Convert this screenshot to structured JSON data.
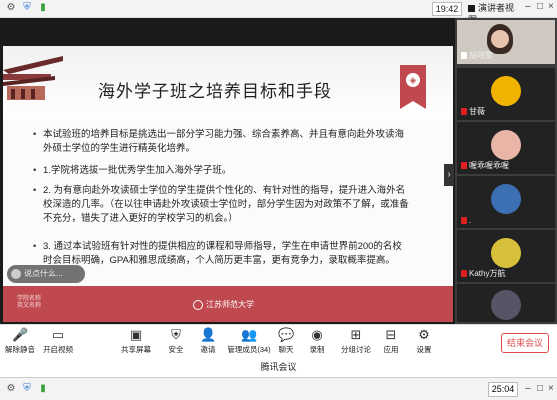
{
  "top_bar": {
    "time": "19:42",
    "view_label": "演讲者视图",
    "view_arrow": "▾",
    "icons": [
      "settings-icon",
      "shield-icon",
      "signal-icon"
    ]
  },
  "slide": {
    "title": "海外学子班之培养目标和手段",
    "badge_icon": "school-emblem-icon",
    "bullets": [
      "本试验班的培养目标是挑选出一部分学习能力强、综合素养高、并且有意向赴外攻读海外硕士学位的学生进行精英化培养。",
      "1.学院将选拔一批优秀学生加入海外学子班。",
      "2. 为有意向赴外攻读硕士学位的学生提供个性化的、有针对性的指导，提升进入海外名校深造的几率。（在以往申请赴外攻读硕士学位时，部分学生因为对政策不了解，或准备不充分，错失了进入更好的学校学习的机会。）",
      "3. 通过本试验班有针对性的提供相应的课程和导师指导，学生在申请世界前200的名校时会目标明确，GPA和雅思成绩高，个人简历更丰富，更有竞争力，录取概率提高。"
    ],
    "footer_left": "学院名称\n英文名称",
    "footer_center": "江苏师范大学",
    "say_something": "说点什么..."
  },
  "participants": [
    {
      "name": "胡晓黎",
      "muted": false
    },
    {
      "name": "甘薇",
      "muted": true
    },
    {
      "name": "喔乖喔乖喔",
      "muted": true
    },
    {
      "name": ".",
      "muted": true
    },
    {
      "name": "Kathy万航",
      "muted": true
    },
    {
      "name": "",
      "muted": true
    }
  ],
  "toolbar": {
    "mute": "解除静音",
    "video": "开启视频",
    "share": "共享屏幕",
    "security": "安全",
    "invite": "邀请",
    "members": "管理成员(34)",
    "chat": "聊天",
    "record": "录制",
    "breakout": "分组讨论",
    "apps": "应用",
    "settings": "设置",
    "end": "结束会议"
  },
  "meeting_title": "腾讯会议",
  "taskbar": {
    "time": "25:04"
  },
  "colors": {
    "accent_red": "#c0494f",
    "end_red": "#e24b4b",
    "panel_bg": "#3c3c3c"
  }
}
